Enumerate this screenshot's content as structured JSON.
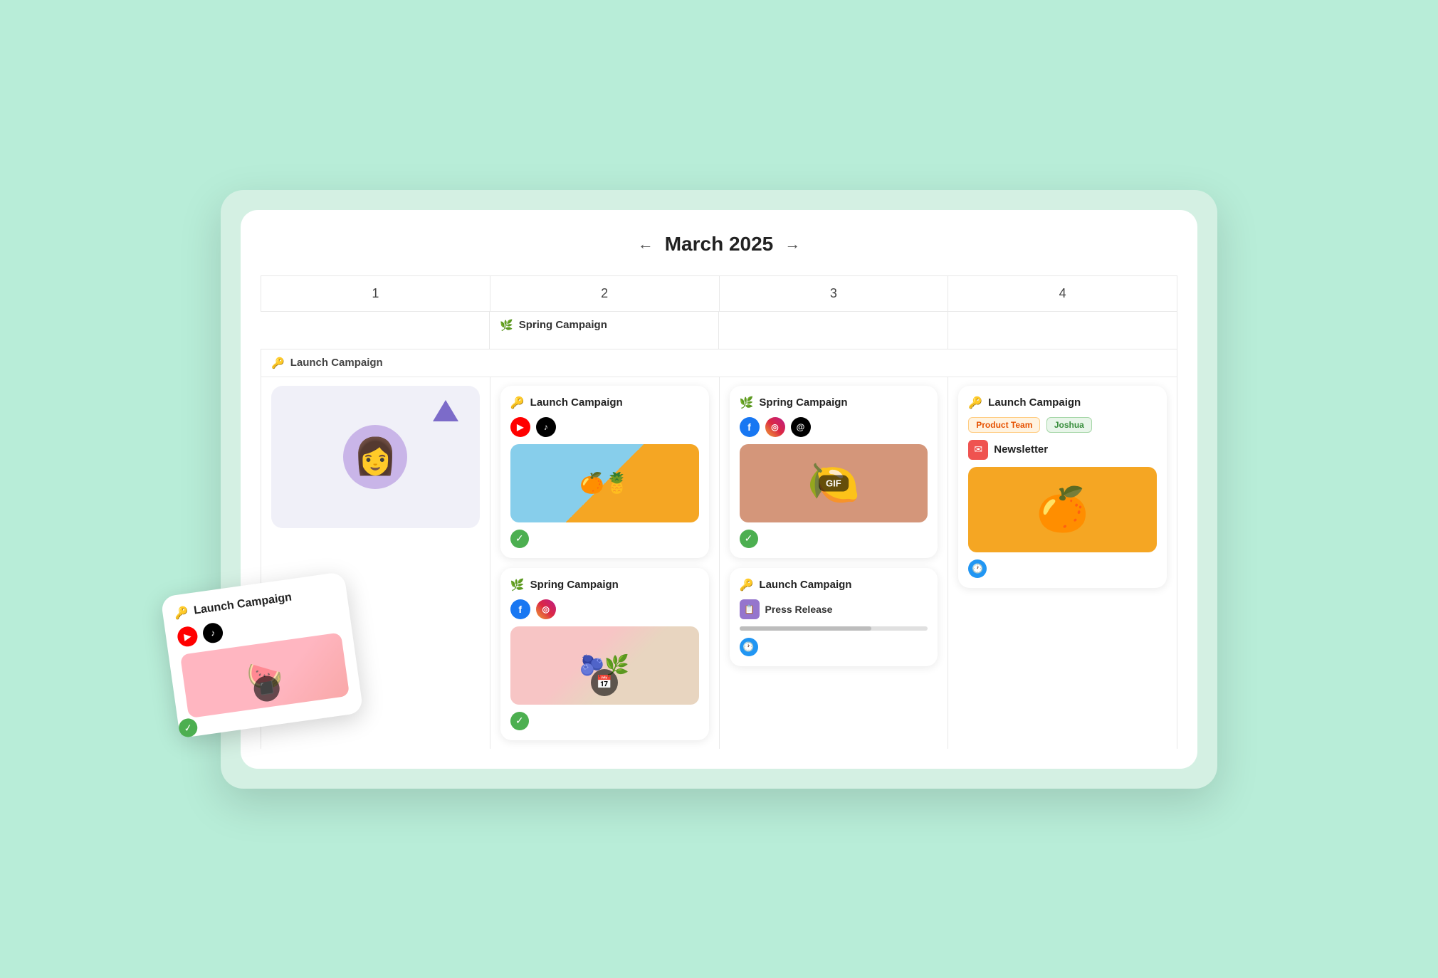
{
  "calendar": {
    "title": "March 2025",
    "prev_arrow": "←",
    "next_arrow": "→",
    "columns": [
      {
        "day": "1"
      },
      {
        "day": "2"
      },
      {
        "day": "3"
      },
      {
        "day": "4"
      }
    ],
    "banners": [
      {
        "type": "empty",
        "label": ""
      },
      {
        "type": "spring",
        "label": "Spring Campaign",
        "icon": "leaf"
      },
      {
        "type": "empty",
        "label": ""
      },
      {
        "type": "empty",
        "label": ""
      }
    ],
    "row_label": "Launch Campaign",
    "row_label_icon": "key"
  },
  "cards": {
    "col1": {
      "empty_card": true,
      "avatar": "👩"
    },
    "col2": [
      {
        "title": "Launch Campaign",
        "icon": "key",
        "socials": [
          "yt",
          "tiktok"
        ],
        "image_type": "orange",
        "check": true
      },
      {
        "title": "Spring Campaign",
        "icon": "leaf",
        "socials": [
          "fb",
          "ig"
        ],
        "image_type": "figs",
        "schedule_badge": true,
        "check": true
      }
    ],
    "col3": [
      {
        "title": "Spring Campaign",
        "icon": "leaf",
        "socials": [
          "fb",
          "ig",
          "threads"
        ],
        "image_type": "lime",
        "gif_badge": "GIF",
        "check": true
      },
      {
        "title": "Launch Campaign",
        "icon": "key",
        "press_release": "Press Release",
        "has_progress": true,
        "clock": true
      }
    ],
    "col4": [
      {
        "title": "Launch Campaign",
        "icon": "key",
        "tags": [
          "Product Team",
          "Joshua"
        ],
        "newsletter": "Newsletter",
        "image_type": "orange2",
        "clock": true
      }
    ]
  },
  "floating": {
    "title": "Launch Campaign",
    "icon": "key",
    "socials": [
      "yt",
      "tiktok"
    ],
    "image_type": "pink",
    "video_badge": "▶",
    "check": true
  },
  "labels": {
    "gif": "GIF",
    "press_release": "Press Release",
    "newsletter": "Newsletter",
    "product_team": "Product Team",
    "joshua": "Joshua",
    "spring_campaign": "Spring Campaign",
    "launch_campaign": "Launch Campaign"
  }
}
